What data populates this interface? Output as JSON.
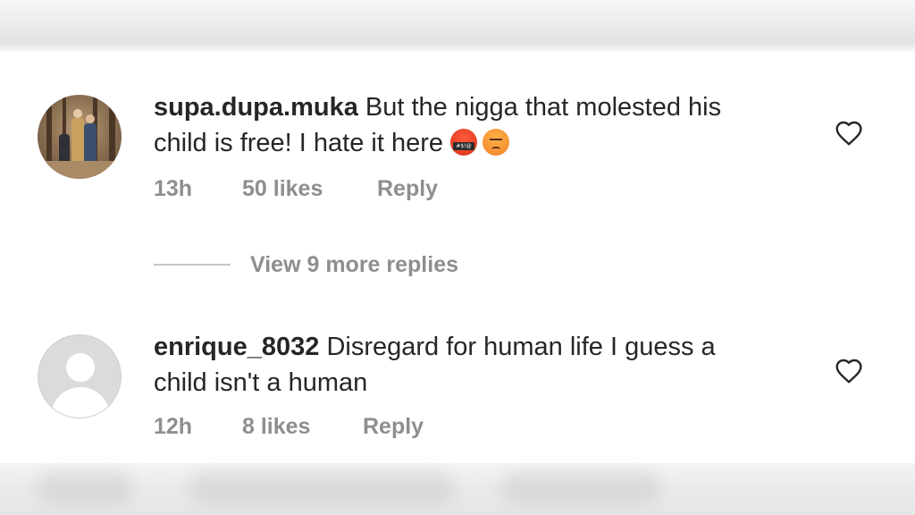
{
  "comments": [
    {
      "username": "supa.dupa.muka",
      "text_line1": "But the nigga that molested his",
      "text_line2": "child is free! I hate it here",
      "emojis": [
        "face-with-symbols-on-mouth-emoji",
        "angry-face-emoji"
      ],
      "time": "13h",
      "likes": "50 likes",
      "reply_label": "Reply",
      "avatar": "photo"
    },
    {
      "username": "enrique_8032",
      "text_line1": "Disregard for human life I guess a",
      "text_line2": "child isn't a human",
      "emojis": [],
      "time": "12h",
      "likes": "8 likes",
      "reply_label": "Reply",
      "avatar": "default"
    }
  ],
  "view_replies_label": "View 9 more replies",
  "icons": {
    "like": "heart-outline-icon"
  },
  "colors": {
    "text_primary": "#262626",
    "text_secondary": "#8e8e8e",
    "divider": "#c7c7c7",
    "avatar_placeholder": "#dbdbdb"
  }
}
